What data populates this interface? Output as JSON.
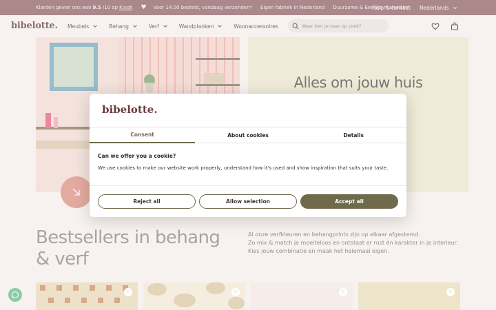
{
  "topbar": {
    "rating_pre": "Klanten geven ons een",
    "rating_value": "9.5",
    "rating_post": "/10 op",
    "rating_link": "Kiyoh",
    "shipping": "Voor 14.00 besteld, vandaag verzonden*",
    "factory": "Eigen fabriek in Nederland",
    "materials": "Duurzame & Eerlijke materialen",
    "help": "Hulp & contact",
    "language": "Nederlands"
  },
  "nav": {
    "logo": "bibelotte.",
    "menu": [
      {
        "label": "Meubels",
        "has_dropdown": true
      },
      {
        "label": "Behang",
        "has_dropdown": true
      },
      {
        "label": "Verf",
        "has_dropdown": true
      },
      {
        "label": "Wandplanken",
        "has_dropdown": true
      },
      {
        "label": "Woonaccessoires",
        "has_dropdown": false
      }
    ],
    "search_placeholder": "Waar ben je naar op zoek?",
    "icons": [
      "search-icon",
      "heart-icon",
      "bag-icon"
    ]
  },
  "hero": {
    "title": "Alles om jouw huis"
  },
  "bestsellers": {
    "title": "Bestsellers in behang & verf",
    "text_lines": [
      "Al onze verfkleuren en behangprints zijn op elkaar afgestemd.",
      "Zo mix & match je moeiteloos en ontstaat er rust én karakter in je interieur.",
      "Kies jouw combinatie en maak het helemaal eigen."
    ]
  },
  "cookie_modal": {
    "logo": "bibelotte.",
    "tabs": [
      {
        "label": "Consent",
        "active": true
      },
      {
        "label": "About cookies",
        "active": false
      },
      {
        "label": "Details",
        "active": false
      }
    ],
    "question": "Can we offer you a cookie?",
    "text": "We use cookies to make our website work properly, understand how it's used and show inspiration that suits your taste.",
    "buttons": {
      "reject": "Reject all",
      "selection": "Allow selection",
      "accept": "Accept all"
    }
  },
  "colors": {
    "topbar": "#8a5a5f",
    "page_bg": "#f4ede9",
    "hero_right": "#ebe3c9",
    "accent": "#6e6a4a",
    "logo": "#6b3b3e"
  }
}
